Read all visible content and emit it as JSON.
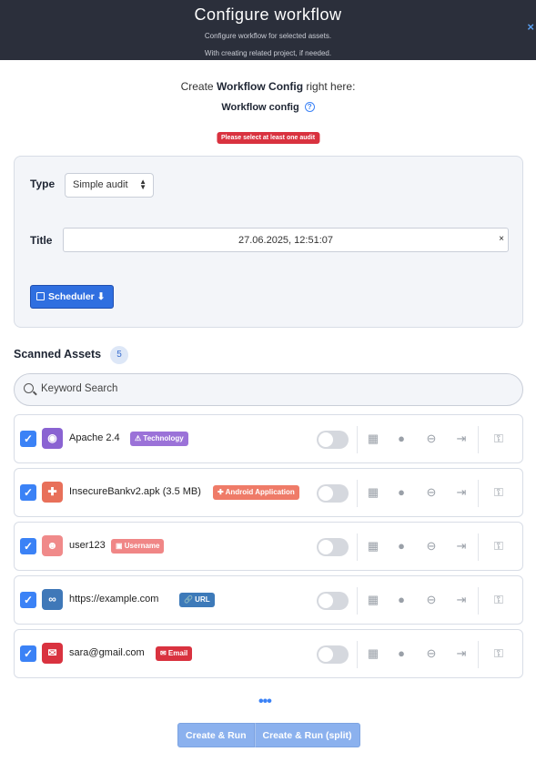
{
  "header": {
    "title": "Configure workflow",
    "subtitle_1": "Configure workflow for selected assets.",
    "subtitle_2": "With creating related project, if needed.",
    "close_icon": "×"
  },
  "intro": {
    "prefix": "Create ",
    "bold": "Workflow Config",
    "suffix": " right here:",
    "config_label": "Workflow config",
    "help_icon": "?"
  },
  "alert": "Please select at least one audit",
  "form": {
    "type_label": "Type",
    "type_value": "Simple audit",
    "title_label": "Title",
    "title_value": "27.06.2025, 12:51:07",
    "clear_icon": "×",
    "scheduler_label": "Scheduler ⬇"
  },
  "assets": {
    "heading": "Scanned Assets",
    "count": "5",
    "search_placeholder": "Keyword Search",
    "items": [
      {
        "name": "Apache 2.4",
        "tag": "⚠ Technology",
        "icon": "eye-icon",
        "glyph": "◉",
        "icon_color": "#8a63d2",
        "tag_color": "#9b72d8"
      },
      {
        "name": "InsecureBankv2.apk (3.5 MB)",
        "tag": "✚ Android Application",
        "icon": "android-icon",
        "glyph": "✚",
        "icon_color": "#e8705a",
        "tag_color": "#ef7b68"
      },
      {
        "name": "user123",
        "tag": "▣ Username",
        "icon": "user-icon",
        "glyph": "☻",
        "icon_color": "#f08a8a",
        "tag_color": "#f08686"
      },
      {
        "name": "https://example.com",
        "tag": "🔗 URL",
        "icon": "link-icon",
        "glyph": "∞",
        "icon_color": "#3f78b8",
        "tag_color": "#3d7ab9"
      },
      {
        "name": "sara@gmail.com",
        "tag": "✉ Email",
        "icon": "mail-icon",
        "glyph": "✉",
        "icon_color": "#d9323f",
        "tag_color": "#d9323f"
      }
    ],
    "actions": {
      "columns": "▦",
      "cookie": "●",
      "minus": "⊖",
      "login": "⇥",
      "key": "⚿"
    },
    "check": "✓"
  },
  "footer": {
    "more": "•••",
    "create_run": "Create & Run",
    "create_run_split": "Create & Run (split)"
  }
}
